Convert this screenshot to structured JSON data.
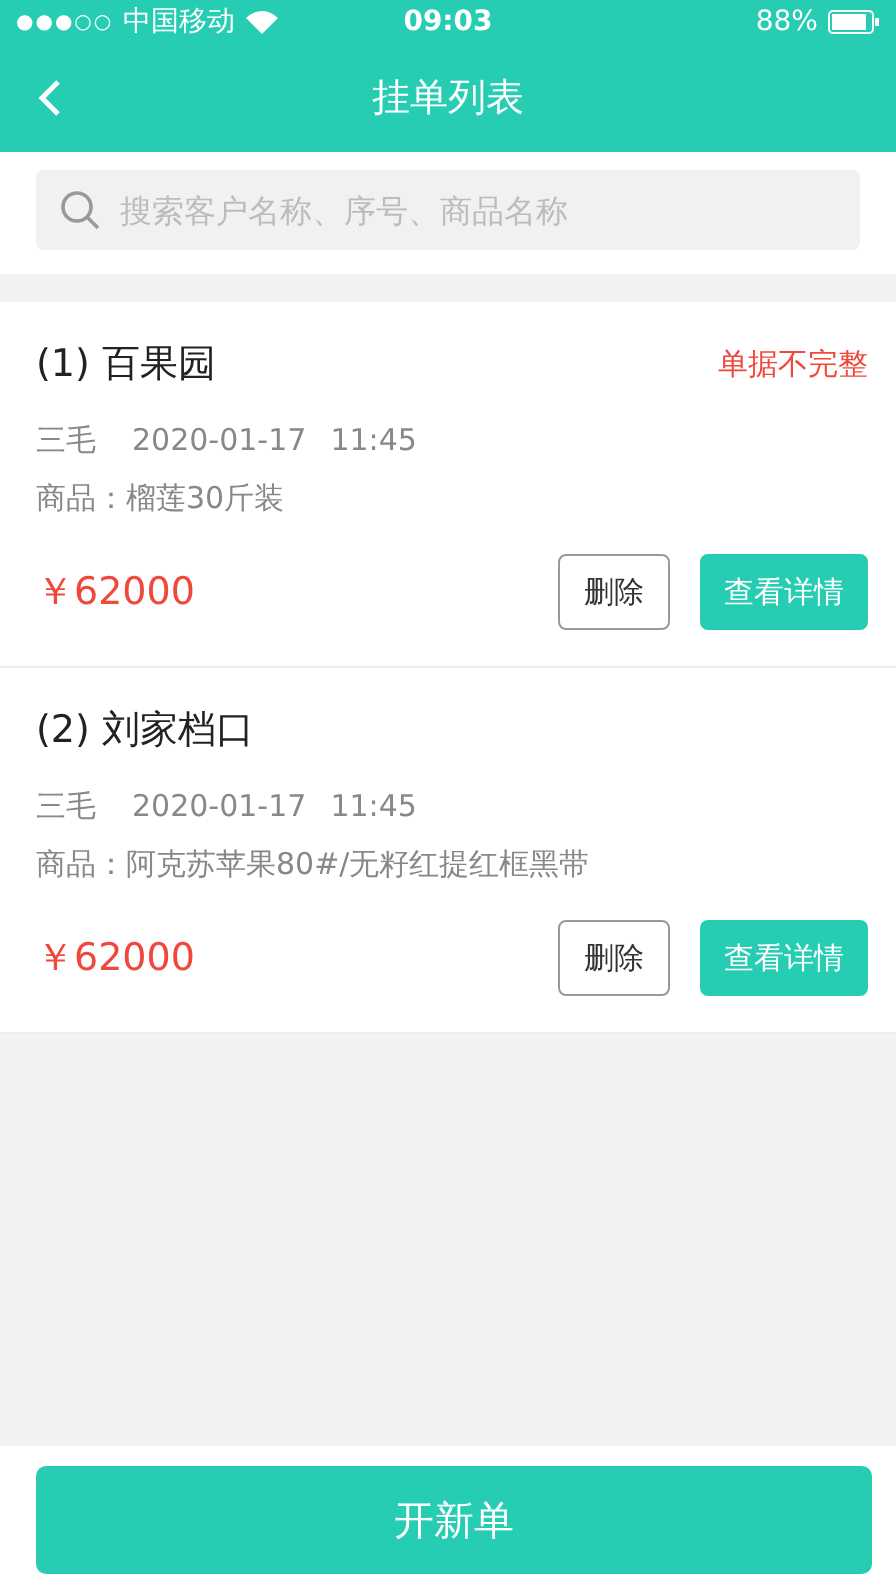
{
  "status_bar": {
    "signal": "●●●○○",
    "carrier": "中国移动",
    "time": "09:03",
    "battery": "88%"
  },
  "nav": {
    "title": "挂单列表"
  },
  "search": {
    "placeholder": "搜索客户名称、序号、商品名称"
  },
  "orders": [
    {
      "title": "(1) 百果园",
      "warning": "单据不完整",
      "person": "三毛",
      "date": "2020-01-17",
      "time": "11:45",
      "goods": "商品：榴莲30斤装",
      "amount": "￥62000",
      "buttons": [
        "删除",
        "查看详情"
      ]
    },
    {
      "title": "(2) 刘家档口",
      "person": "三毛",
      "date": "2020-01-17",
      "time": "11:45",
      "goods": "商品：阿克苏苹果80#/无籽红提红框黑带",
      "amount": "￥62000",
      "buttons": [
        "删除",
        "查看详情"
      ]
    }
  ],
  "footer": {
    "button": "开新单"
  }
}
